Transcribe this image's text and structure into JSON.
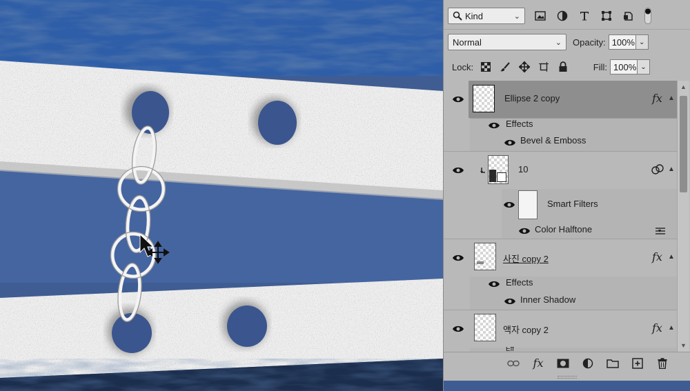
{
  "filter": {
    "kind_label": "Kind"
  },
  "blend": {
    "mode": "Normal",
    "opacity_label": "Opacity:",
    "opacity_value": "100%",
    "lock_label": "Lock:",
    "fill_label": "Fill:",
    "fill_value": "100%"
  },
  "layers": [
    {
      "name": "Ellipse 2 copy",
      "selected": true,
      "has_fx": true,
      "effects_label": "Effects",
      "effects": [
        "Bevel & Emboss"
      ]
    },
    {
      "name": "10",
      "selected": false,
      "smart_object": true,
      "smart_filters_label": "Smart Filters",
      "filters": [
        "Color Halftone"
      ]
    },
    {
      "name": "사진 copy 2",
      "selected": false,
      "has_fx": true,
      "effects_label": "Effects",
      "effects": [
        "Inner Shadow"
      ]
    },
    {
      "name": "액자 copy 2",
      "selected": false,
      "has_fx": true,
      "effects_label": "Eff"
    }
  ],
  "icons": {
    "fx": "fx",
    "footer": [
      "link-icon",
      "fx-icon",
      "mask-icon",
      "adjustment-icon",
      "folder-icon",
      "new-layer-icon",
      "trash-icon"
    ]
  },
  "colors": {
    "panel_bg": "#b9b9b9",
    "selected_row": "#8e8e8e",
    "canvas_blue": "#3d5a8f",
    "plank_white": "#ededed"
  }
}
